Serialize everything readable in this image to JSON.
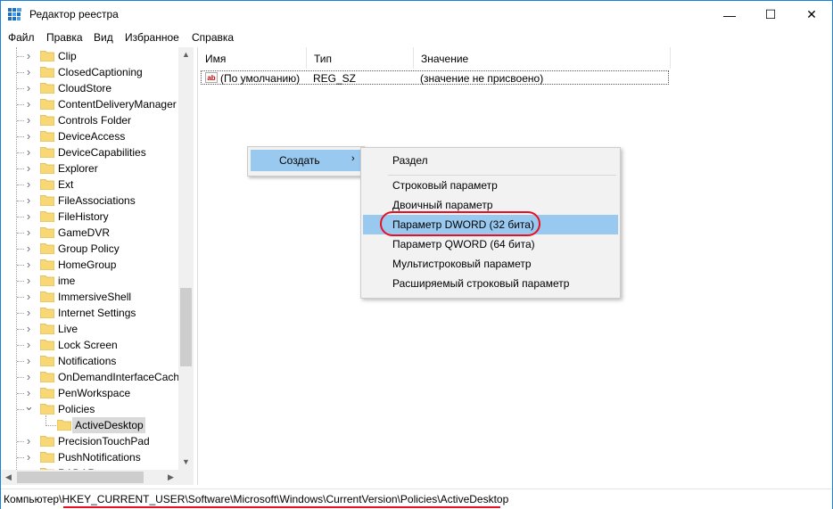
{
  "window": {
    "title": "Редактор реестра",
    "controls": {
      "minimize": "—",
      "maximize": "☐",
      "close": "✕"
    }
  },
  "menu": [
    "Файл",
    "Правка",
    "Вид",
    "Избранное",
    "Справка"
  ],
  "tree": {
    "items": [
      {
        "label": "Clip",
        "expandable": true
      },
      {
        "label": "ClosedCaptioning",
        "expandable": true
      },
      {
        "label": "CloudStore",
        "expandable": true
      },
      {
        "label": "ContentDeliveryManager",
        "expandable": true
      },
      {
        "label": "Controls Folder",
        "expandable": true
      },
      {
        "label": "DeviceAccess",
        "expandable": true
      },
      {
        "label": "DeviceCapabilities",
        "expandable": true
      },
      {
        "label": "Explorer",
        "expandable": true
      },
      {
        "label": "Ext",
        "expandable": true
      },
      {
        "label": "FileAssociations",
        "expandable": true
      },
      {
        "label": "FileHistory",
        "expandable": true
      },
      {
        "label": "GameDVR",
        "expandable": true
      },
      {
        "label": "Group Policy",
        "expandable": true
      },
      {
        "label": "HomeGroup",
        "expandable": true
      },
      {
        "label": "ime",
        "expandable": true
      },
      {
        "label": "ImmersiveShell",
        "expandable": true
      },
      {
        "label": "Internet Settings",
        "expandable": true
      },
      {
        "label": "Live",
        "expandable": true
      },
      {
        "label": "Lock Screen",
        "expandable": true
      },
      {
        "label": "Notifications",
        "expandable": true
      },
      {
        "label": "OnDemandInterfaceCach",
        "expandable": true
      },
      {
        "label": "PenWorkspace",
        "expandable": true
      },
      {
        "label": "Policies",
        "expandable": true,
        "expanded": true
      },
      {
        "label": "ActiveDesktop",
        "child": true,
        "selected": true
      },
      {
        "label": "PrecisionTouchPad",
        "expandable": true
      },
      {
        "label": "PushNotifications",
        "expandable": true
      },
      {
        "label": "RADAR",
        "expandable": true
      }
    ]
  },
  "list": {
    "columns": [
      "Имя",
      "Тип",
      "Значение"
    ],
    "rows": [
      {
        "icon": "ab",
        "name": "(По умолчанию)",
        "type": "REG_SZ",
        "value": "(значение не присвоено)"
      }
    ]
  },
  "context_menu": {
    "item": "Создать",
    "arrow": "›",
    "submenu": [
      "Раздел",
      "Строковый параметр",
      "Двоичный параметр",
      "Параметр DWORD (32 бита)",
      "Параметр QWORD (64 бита)",
      "Мультистроковый параметр",
      "Расширяемый строковый параметр"
    ],
    "highlighted_index": 3
  },
  "statusbar": {
    "path": "Компьютер\\HKEY_CURRENT_USER\\Software\\Microsoft\\Windows\\CurrentVersion\\Policies\\ActiveDesktop"
  },
  "colors": {
    "highlight": "#99c9ef",
    "annotation_red": "#e81123",
    "folder": "#f8d775"
  }
}
